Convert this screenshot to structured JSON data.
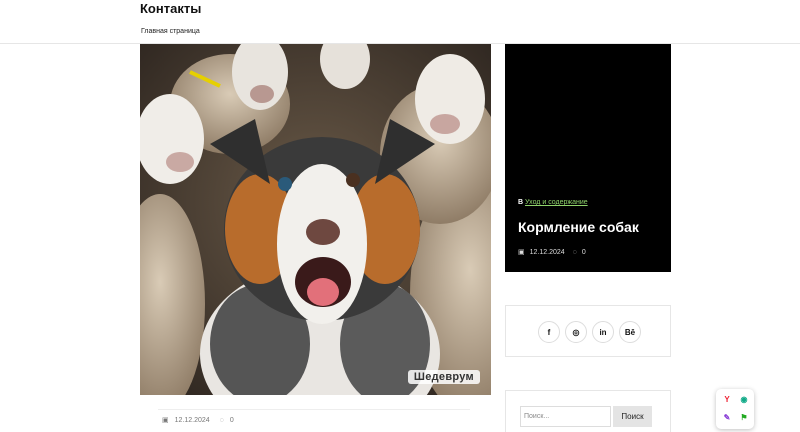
{
  "header": {
    "title": "Контакты",
    "breadcrumb": "Главная страница"
  },
  "hero": {
    "watermark": "Шедеврум"
  },
  "post_meta": {
    "date": "12.12.2024",
    "comments": "0"
  },
  "featured": {
    "category_prefix": "В",
    "category": "Уход и содержание",
    "title": "Кормление собак",
    "date": "12.12.2024",
    "comments": "0"
  },
  "social": [
    {
      "icon": "facebook-icon",
      "glyph": "f"
    },
    {
      "icon": "instagram-icon",
      "glyph": "◎"
    },
    {
      "icon": "linkedin-icon",
      "glyph": "in"
    },
    {
      "icon": "behance-icon",
      "glyph": "Bē"
    }
  ],
  "search": {
    "placeholder": "Поиск...",
    "button": "Поиск"
  },
  "colors": {
    "accent_link": "#8fd36b",
    "card_bg": "#000000"
  }
}
